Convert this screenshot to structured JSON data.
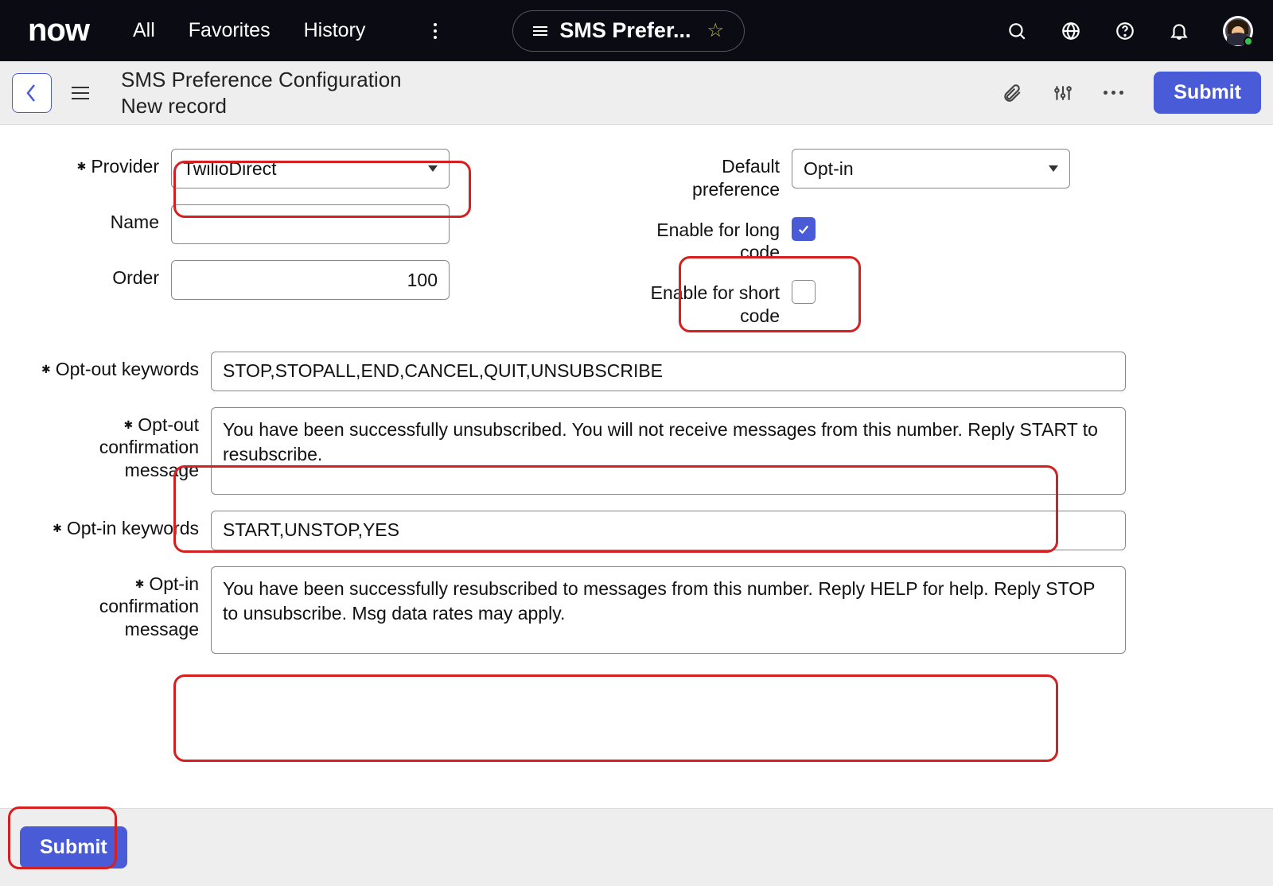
{
  "topnav": {
    "logo": "now",
    "items": [
      "All",
      "Favorites",
      "History"
    ],
    "context_title": "SMS Prefer..."
  },
  "header": {
    "title_line1": "SMS Preference Configuration",
    "title_line2": "New record",
    "submit_label": "Submit"
  },
  "form": {
    "provider": {
      "label": "Provider",
      "value": "TwilioDirect"
    },
    "name": {
      "label": "Name",
      "value": ""
    },
    "order": {
      "label": "Order",
      "value": "100"
    },
    "default_pref": {
      "label": "Default preference",
      "value": "Opt-in"
    },
    "enable_long": {
      "label": "Enable for long code",
      "checked": true
    },
    "enable_short": {
      "label": "Enable for short code",
      "checked": false
    },
    "optout_keywords": {
      "label": "Opt-out keywords",
      "value": "STOP,STOPALL,END,CANCEL,QUIT,UNSUBSCRIBE"
    },
    "optout_msg": {
      "label": "Opt-out confirmation message",
      "value": "You have been successfully unsubscribed. You will not receive messages from this number. Reply START to resubscribe."
    },
    "optin_keywords": {
      "label": "Opt-in keywords",
      "value": "START,UNSTOP,YES"
    },
    "optin_msg": {
      "label": "Opt-in confirmation message",
      "value": "You have been successfully resubscribed to messages from this number. Reply HELP for help. Reply STOP to unsubscribe. Msg data rates may apply."
    }
  },
  "footer": {
    "submit_label": "Submit"
  }
}
